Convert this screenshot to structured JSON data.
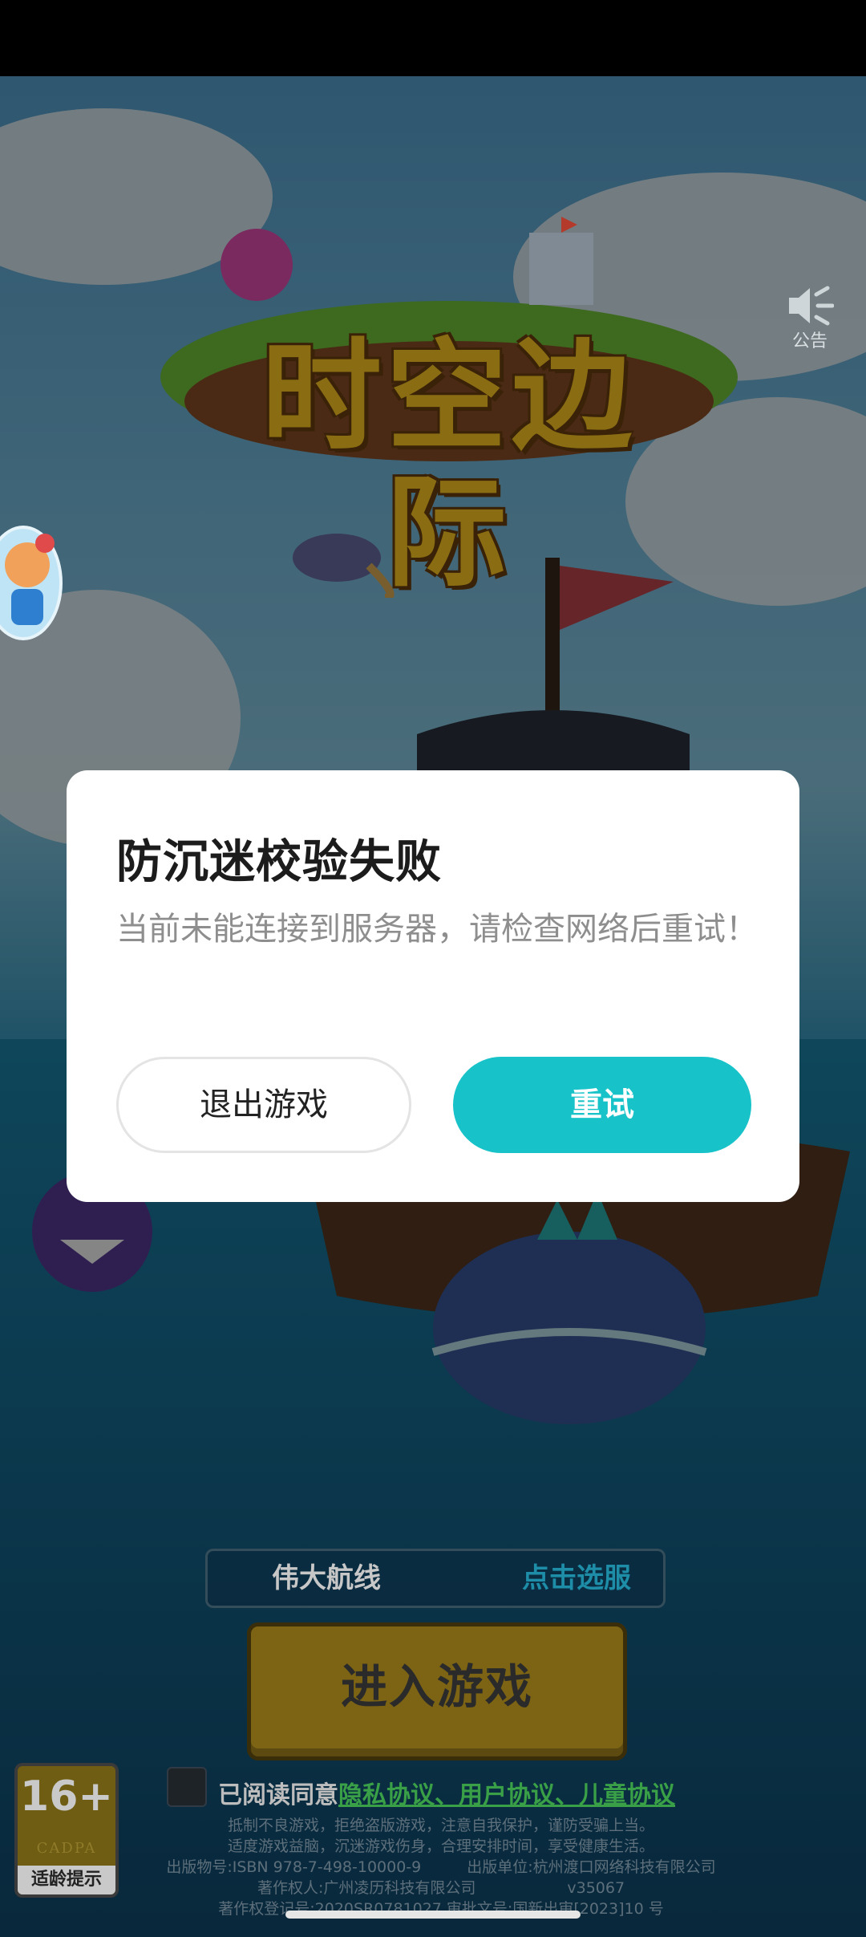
{
  "announce": {
    "label": "公告"
  },
  "game": {
    "title": "时空边际"
  },
  "server": {
    "name": "伟大航线",
    "select_label": "点击选服"
  },
  "enter_button": {
    "label": "进入游戏"
  },
  "age_rating": {
    "number": "16+",
    "org": "CADPA",
    "tip": "适龄提示"
  },
  "agreement": {
    "prefix": "已阅读同意",
    "links": "隐私协议、用户协议、儿童协议"
  },
  "legal": {
    "line1": "抵制不良游戏，拒绝盗版游戏，注意自我保护，谨防受骗上当。",
    "line2": "适度游戏益脑，沉迷游戏伤身，合理安排时间，享受健康生活。",
    "line3": "出版物号:ISBN 978-7-498-10000-9　　　出版单位:杭州渡口网络科技有限公司",
    "line4": "著作权人:广州凌历科技有限公司　　　　　　v35067",
    "line5": "著作权登记号:2020SR0781027 审批文号:国新出审[2023]10 号"
  },
  "dialog": {
    "title": "防沉迷校验失败",
    "message": "当前未能连接到服务器，请检查网络后重试！",
    "exit_label": "退出游戏",
    "retry_label": "重试"
  },
  "colors": {
    "accent": "#17c3c9",
    "link": "#39a047"
  }
}
